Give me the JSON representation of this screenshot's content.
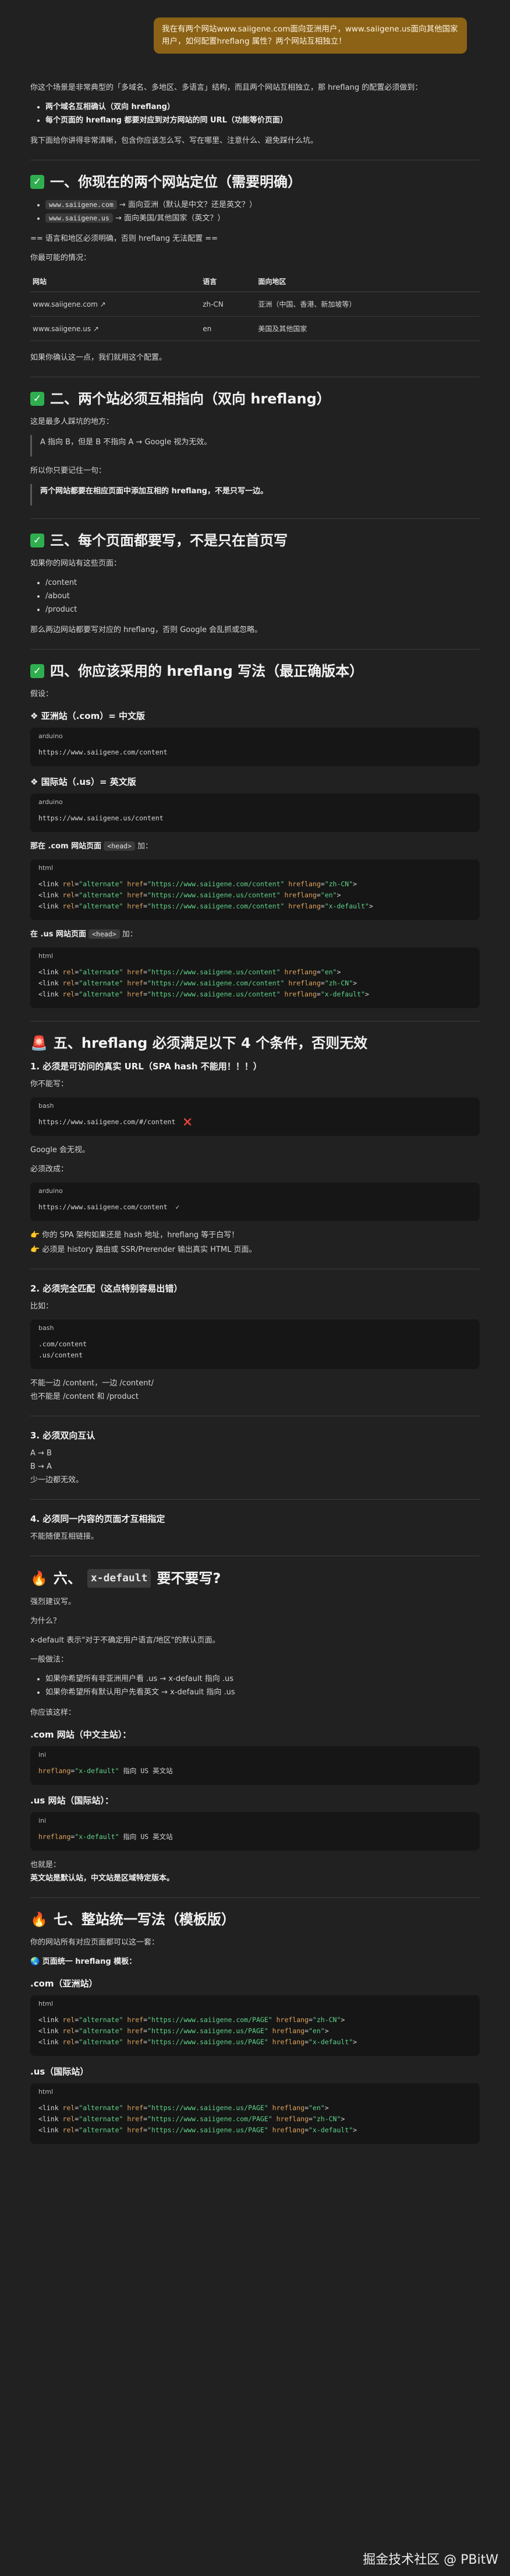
{
  "user_message": "我在有两个网站www.saiigene.com面向亚洲用户，www.saiigene.us面向其他国家用户，如何配置hreflang 属性？两个网站互相独立！",
  "intro": {
    "p1": "你这个场景是非常典型的「多域名、多地区、多语言」结构，而且两个网站互相独立，那 hreflang 的配置必须做到：",
    "bullets": [
      "两个域名互相确认（双向 hreflang）",
      "每个页面的 hreflang 都要对应到对方网站的同 URL（功能等价页面）"
    ],
    "p2": "我下面给你讲得非常清晰，包含你应该怎么写、写在哪里、注意什么、避免踩什么坑。"
  },
  "s1": {
    "title": "一、你现在的两个网站定位（需要明确）",
    "b1_code": "www.saiigene.com",
    "b1_text": "→ 面向亚洲（默认是中文？还是英文？）",
    "b2_code": "www.saiigene.us",
    "b2_text": "→ 面向美国/其他国家（英文？）",
    "note": "== 语言和地区必须明确，否则 hreflang 无法配置 ==",
    "p_guess": "你最可能的情况：",
    "table_headers": [
      "网站",
      "语言",
      "面向地区"
    ],
    "rows": [
      [
        "www.saiigene.com ↗",
        "zh-CN",
        "亚洲（中国、香港、新加坡等）"
      ],
      [
        "www.saiigene.us ↗",
        "en",
        "美国及其他国家"
      ]
    ],
    "p_confirm": "如果你确认这一点，我们就用这个配置。"
  },
  "s2": {
    "title": "二、两个站必须互相指向（双向 hreflang）",
    "p1": "这是最多人踩坑的地方：",
    "quote1": "A 指向 B，但是 B 不指向 A → Google 视为无效。",
    "p2": "所以你只要记住一句：",
    "quote2": "两个网站都要在相应页面中添加互相的 hreflang，不是只写一边。"
  },
  "s3": {
    "title": "三、每个页面都要写，不是只在首页写",
    "p1": "如果你的网站有这些页面：",
    "items": [
      "/content",
      "/about",
      "/product"
    ],
    "p2": "那么两边网站都要写对应的 hreflang，否则 Google 会乱抓或忽略。"
  },
  "s4": {
    "title": "四、你应该采用的 hreflang 写法（最正确版本）",
    "p_assume": "假设：",
    "asia_h": "❖ 亚洲站（.com）= 中文版",
    "asia_lang": "arduino",
    "asia_code": "https://www.saiigene.com/content",
    "intl_h": "❖ 国际站（.us）= 英文版",
    "intl_lang": "arduino",
    "intl_code": "https://www.saiigene.us/content",
    "com_head_pre": "那在 .com 网站页面",
    "com_head_code": "<head>",
    "com_head_post": "加：",
    "com_lang": "html",
    "com_links": [
      {
        "rel": "alternate",
        "href": "https://www.saiigene.com/content",
        "hreflang": "zh-CN"
      },
      {
        "rel": "alternate",
        "href": "https://www.saiigene.us/content",
        "hreflang": "en"
      },
      {
        "rel": "alternate",
        "href": "https://www.saiigene.com/content",
        "hreflang": "x-default"
      }
    ],
    "us_head_pre": "在 .us 网站页面",
    "us_head_code": "<head>",
    "us_head_post": "加：",
    "us_lang": "html",
    "us_links": [
      {
        "rel": "alternate",
        "href": "https://www.saiigene.us/content",
        "hreflang": "en"
      },
      {
        "rel": "alternate",
        "href": "https://www.saiigene.com/content",
        "hreflang": "zh-CN"
      },
      {
        "rel": "alternate",
        "href": "https://www.saiigene.us/content",
        "hreflang": "x-default"
      }
    ]
  },
  "s5": {
    "title": "五、hreflang 必须满足以下 4 个条件，否则无效",
    "c1_title": "1. 必须是可访问的真实 URL（SPA hash 不能用！！！）",
    "c1_p1": "你不能写：",
    "c1_bad_lang": "bash",
    "c1_bad_code": "https://www.saiigene.com/#/content",
    "c1_bad_mark": "❌",
    "c1_p2": "Google 会无视。",
    "c1_p3": "必须改成：",
    "c1_good_lang": "arduino",
    "c1_good_code": "https://www.saiigene.com/content",
    "c1_good_mark": "✓",
    "c1_p4": "👉 你的 SPA 架构如果还是 hash 地址，hreflang 等于白写！",
    "c1_p5": "👉 必须是 history 路由或 SSR/Prerender 输出真实 HTML 页面。",
    "c2_title": "2. 必须完全匹配（这点特别容易出错）",
    "c2_p1": "比如：",
    "c2_lang": "bash",
    "c2_code": ".com/content\n.us/content",
    "c2_p2": "不能一边 /content，一边 /content/",
    "c2_p3": "也不能是 /content 和 /product",
    "c3_title": "3. 必须双向互认",
    "c3_lines": [
      "A → B",
      "B → A",
      "少一边都无效。"
    ],
    "c4_title": "4. 必须同一内容的页面才互相指定",
    "c4_p": "不能随便互相链接。"
  },
  "s6": {
    "title_pre": "六、",
    "title_code": "x-default",
    "title_post": "要不要写?",
    "p1": "强烈建议写。",
    "p2": "为什么？",
    "p3": "x-default 表示\"对于不确定用户语言/地区\"的默认页面。",
    "p4": "一般做法：",
    "bullets": [
      "如果你希望所有非亚洲用户看 .us → x-default 指向 .us",
      "如果你希望所有默认用户先看英文 → x-default 指向 .us"
    ],
    "p5": "你应该这样：",
    "com_h": ".com 网站（中文主站）：",
    "com_lang": "ini",
    "com_code_attr": "hreflang",
    "com_code_val": "\"x-default\"",
    "com_code_tail": " 指向 US 英文站",
    "us_h": ".us 网站（国际站）：",
    "us_lang": "ini",
    "us_code_attr": "hreflang",
    "us_code_val": "\"x-default\"",
    "us_code_tail": " 指向 US 英文站",
    "p6": "也就是：",
    "p7": "英文站是默认站，中文站是区域特定版本。"
  },
  "s7": {
    "title": "七、整站统一写法（模板版）",
    "p1": "你的网站所有对应页面都可以这一套：",
    "sub": "页面统一 hreflang 模板：",
    "com_h": ".com（亚洲站）",
    "com_lang": "html",
    "com_links": [
      {
        "rel": "alternate",
        "href": "https://www.saiigene.com/PAGE",
        "hreflang": "zh-CN"
      },
      {
        "rel": "alternate",
        "href": "https://www.saiigene.us/PAGE",
        "hreflang": "en"
      },
      {
        "rel": "alternate",
        "href": "https://www.saiigene.us/PAGE",
        "hreflang": "x-default"
      }
    ],
    "us_h": ".us（国际站）",
    "us_lang": "html",
    "us_links": [
      {
        "rel": "alternate",
        "href": "https://www.saiigene.us/PAGE",
        "hreflang": "en"
      },
      {
        "rel": "alternate",
        "href": "https://www.saiigene.com/PAGE",
        "hreflang": "zh-CN"
      },
      {
        "rel": "alternate",
        "href": "https://www.saiigene.us/PAGE",
        "hreflang": "x-default"
      }
    ]
  },
  "watermark": "掘金技术社区 @ PBitW"
}
